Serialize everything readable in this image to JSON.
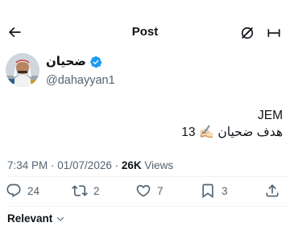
{
  "header": {
    "title": "Post",
    "back_icon": "arrow-left-icon",
    "grok_icon": "grok-icon",
    "more_icon": "more-vertical-icon"
  },
  "author": {
    "display_name": "ضحيان",
    "handle": "@dahayyan1",
    "verified": true,
    "verified_color": "#1d9bf0"
  },
  "tweet": {
    "line1": "JEM",
    "line2": "هدف ضحيان ✍🏻 13"
  },
  "meta": {
    "timestamp": "7:34 PM · 01/07/2026 · ",
    "views_count": "26K",
    "views_label": " Views"
  },
  "actions": {
    "reply_count": "24",
    "repost_count": "2",
    "like_count": "7",
    "bookmark_count": "3"
  },
  "sort": {
    "label": "Relevant"
  },
  "colors": {
    "text_primary": "#0f1419",
    "text_secondary": "#536471",
    "divider": "#eff3f4"
  }
}
